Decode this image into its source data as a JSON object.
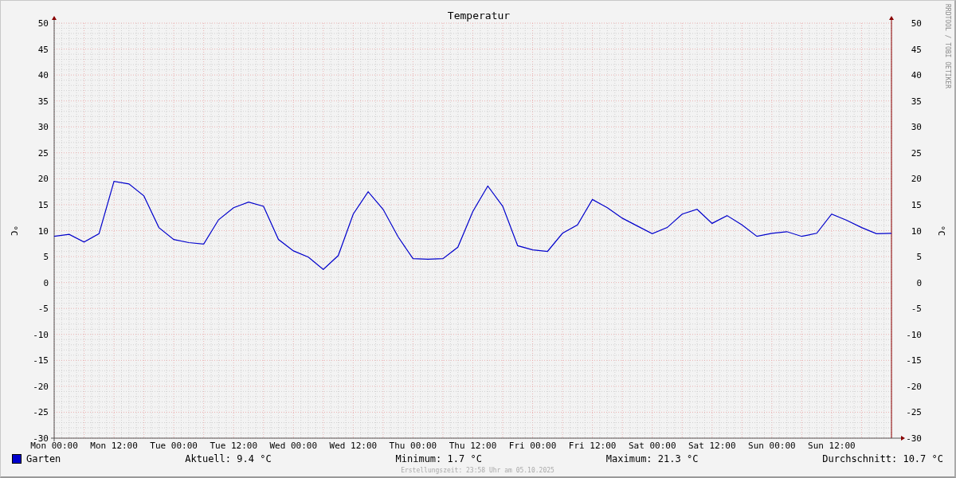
{
  "graph": {
    "chart_data": {
      "type": "line",
      "title": "Temperatur",
      "ylabel": "°C",
      "categories": [
        "Mon 00:00",
        null,
        null,
        null,
        "Mon 12:00",
        null,
        null,
        null,
        "Tue 00:00",
        null,
        null,
        null,
        "Tue 12:00",
        null,
        null,
        null,
        "Wed 00:00",
        null,
        null,
        null,
        "Wed 12:00",
        null,
        null,
        null,
        "Thu 00:00",
        null,
        null,
        null,
        "Thu 12:00",
        null,
        null,
        null,
        "Fri 00:00",
        null,
        null,
        null,
        "Fri 12:00",
        null,
        null,
        null,
        "Sat 00:00",
        null,
        null,
        null,
        "Sat 12:00",
        null,
        null,
        null,
        "Sun 00:00",
        null,
        null,
        null,
        "Sun 12:00",
        null,
        null,
        null,
        null
      ],
      "series": [
        {
          "name": "Garten",
          "color": "#0000cc",
          "values": [
            8.9,
            9.3,
            7.8,
            9.4,
            19.5,
            19.0,
            16.7,
            10.6,
            8.3,
            7.7,
            7.4,
            12.1,
            14.4,
            15.5,
            14.7,
            8.3,
            6.1,
            4.9,
            2.5,
            5.2,
            13.2,
            17.5,
            14.1,
            8.8,
            4.6,
            4.5,
            4.6,
            6.8,
            13.7,
            18.6,
            14.7,
            7.1,
            6.3,
            6.0,
            9.5,
            11.1,
            16.0,
            14.4,
            12.4,
            10.9,
            9.4,
            10.6,
            13.2,
            14.1,
            11.4,
            12.9,
            11.1,
            8.9,
            9.5,
            9.8,
            8.9,
            9.5,
            13.2,
            12.0,
            10.6,
            9.4,
            9.5
          ]
        }
      ],
      "ylim": [
        -30,
        50
      ],
      "yticks": [
        -30,
        -25,
        -20,
        -15,
        -10,
        -5,
        0,
        5,
        10,
        15,
        20,
        25,
        30,
        35,
        40,
        45,
        50
      ],
      "grid": true
    },
    "right_axis": {
      "label": "°C",
      "yticks": [
        "50",
        "45",
        "40",
        "35",
        "30",
        "25",
        "20",
        "15",
        "10",
        "5",
        "0",
        "-5",
        "-10",
        "-15",
        "-20",
        "-25",
        "-30"
      ]
    },
    "credit": "RRDTOOL / TOBI OETIKER"
  },
  "legend": {
    "stats": [
      "Aktuell: 9.4 °C",
      "Minimum: 1.7 °C",
      "Maximum: 21.3 °C",
      "Durchschnitt: 10.7 °C"
    ]
  },
  "footer": "Erstellungszeit: 23:58 Uhr am 05.10.2025"
}
